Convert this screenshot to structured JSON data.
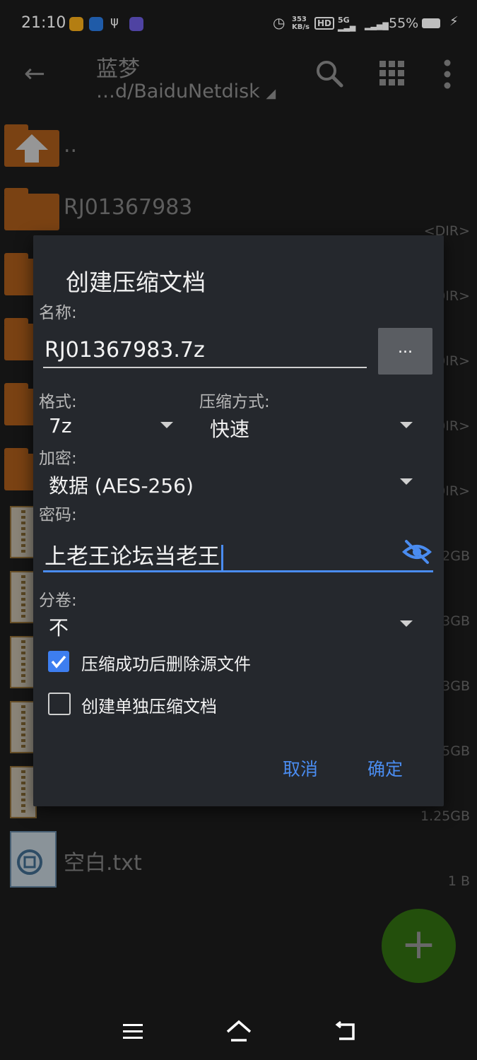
{
  "status": {
    "time": "21:10",
    "speed": "353",
    "speed_unit": "KB/s",
    "hd": "HD",
    "net": "5G",
    "battery": "55%"
  },
  "appbar": {
    "title": "蓝梦",
    "path": "…d/BaiduNetdisk"
  },
  "list": {
    "up_name": "..",
    "folder1_name": "RJ01367983",
    "dir_tag": "<DIR>",
    "dir_partial": "DIR>",
    "size_2gb": "2GB",
    "size_3gb_a": "3GB",
    "size_3gb_b": "3GB",
    "size_5gb": "5GB",
    "size_125": "1.25GB",
    "txt_name": "空白.txt",
    "txt_size": "1 B"
  },
  "dialog": {
    "title": "创建压缩文档",
    "name_label": "名称:",
    "name_value": "RJ01367983.7z",
    "browse_label": "...",
    "format_label": "格式:",
    "format_value": "7z",
    "method_label": "压缩方式:",
    "method_value": "快速",
    "encrypt_label": "加密:",
    "encrypt_value": "数据 (AES-256)",
    "password_label": "密码:",
    "password_value": "上老王论坛当老王",
    "split_label": "分卷:",
    "split_value": "不",
    "delete_source_label": "压缩成功后删除源文件",
    "delete_source_checked": true,
    "separate_label": "创建单独压缩文档",
    "separate_checked": false,
    "cancel": "取消",
    "ok": "确定"
  },
  "colors": {
    "accent": "#4a8cf0",
    "folder": "#a3581a",
    "fab": "#2f6a10",
    "dialog_bg": "#25282d"
  }
}
